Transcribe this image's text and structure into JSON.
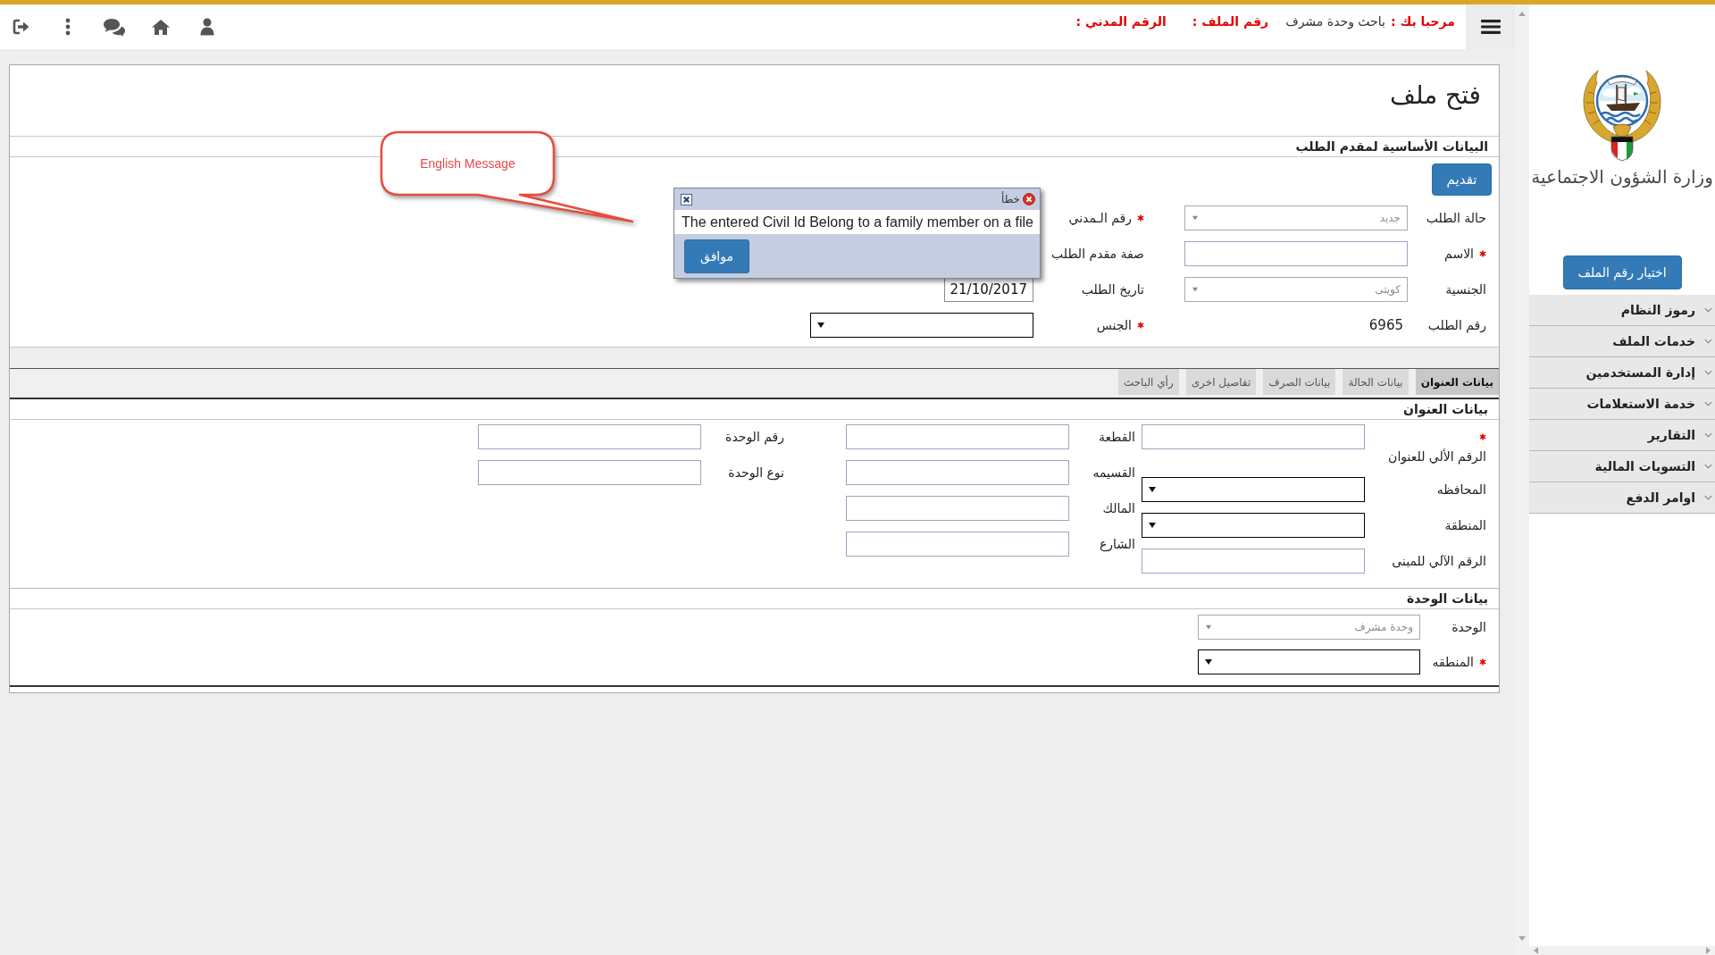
{
  "header": {
    "welcome_label": "مرحبا بك :",
    "user_name": "باحث وحدة مشرف",
    "file_number_label": "رقم الملف :",
    "civil_id_label": "الرقم المدني :"
  },
  "page_title": "فتح ملف",
  "applicant_section": {
    "title": "البيانات الأساسية لمقدم الطلب",
    "submit_button": "تقديم",
    "rows": [
      {
        "fields": [
          {
            "label": "حالة الطلب",
            "required": false,
            "kind": "select",
            "value": "جديد",
            "disabled": true
          },
          {
            "label": "رقم الـمدني",
            "required": true
          }
        ]
      },
      {
        "fields": [
          {
            "label": "الاسم",
            "required": true,
            "kind": "input",
            "disabled": false
          },
          {
            "label": "صفة مقدم الطلب",
            "required": false
          }
        ]
      },
      {
        "fields": [
          {
            "label": "الجنسية",
            "required": false,
            "kind": "select",
            "value": "كويتى",
            "disabled": true
          },
          {
            "label": "تاريخ الطلب",
            "required": false,
            "kind": "date",
            "value": "21/10/2017",
            "disabled": false
          }
        ]
      },
      {
        "fields": [
          {
            "label": "رقم الطلب",
            "required": false,
            "kind": "text",
            "value": "6965"
          },
          {
            "label": "الجنس",
            "required": true,
            "kind": "select",
            "disabled": false
          }
        ]
      }
    ]
  },
  "tabs": [
    {
      "label": "بيانات العنوان",
      "selected": true
    },
    {
      "label": "بيانات الحالة",
      "selected": false
    },
    {
      "label": "بيانات الصرف",
      "selected": false
    },
    {
      "label": "تفاصيل اخرى",
      "selected": false
    },
    {
      "label": "رأي الباحث",
      "selected": false
    }
  ],
  "address_section": {
    "title": "بيانات العنوان",
    "columns": [
      {
        "fields": [
          {
            "label": "الرقم الألي للعنوان",
            "required": true,
            "kind": "input",
            "disabled": false
          },
          {
            "label": "المحافظه",
            "required": false,
            "kind": "select",
            "disabled": false
          },
          {
            "label": "المنطقة",
            "required": false,
            "kind": "select",
            "disabled": false
          },
          {
            "label": "الرقم الآلي للمبنى",
            "required": false,
            "kind": "input",
            "disabled": false
          }
        ]
      },
      {
        "fields": [
          {
            "label": "القطعة",
            "required": false,
            "kind": "input",
            "disabled": false
          },
          {
            "label": "القسيمه",
            "required": false,
            "kind": "input",
            "disabled": false
          },
          {
            "label": "المالك",
            "required": false,
            "kind": "input",
            "disabled": false
          },
          {
            "label": "الشارع",
            "required": false,
            "kind": "input",
            "disabled": false
          }
        ]
      },
      {
        "fields": [
          {
            "label": "رقم الوحدة",
            "required": false,
            "kind": "input",
            "disabled": false
          },
          {
            "label": "نوع الوحدة",
            "required": false,
            "kind": "input",
            "disabled": false
          }
        ]
      }
    ]
  },
  "unit_section": {
    "title": "بيانات الوحدة",
    "fields": [
      {
        "label": "الوحدة",
        "required": false,
        "kind": "select",
        "value": "وحدة مشرف",
        "disabled": true
      },
      {
        "label": "المنطقه",
        "required": true,
        "kind": "select",
        "disabled": false
      }
    ]
  },
  "dialog": {
    "title": "خطأ",
    "message": "The entered Civil Id Belong to a family member on a file",
    "ok_button": "موافق"
  },
  "callout": {
    "text": "English Message"
  },
  "sidebar": {
    "logo_text": "وزارة الشؤون الاجتماعية",
    "select_file_button": "اختيار رقم الملف",
    "menu": [
      "رموز النظام",
      "خدمات الملف",
      "إدارة المستخدمين",
      "خدمة الاستعلامات",
      "التقارير",
      "التسويات المالية",
      "اوامر الدفع"
    ]
  }
}
